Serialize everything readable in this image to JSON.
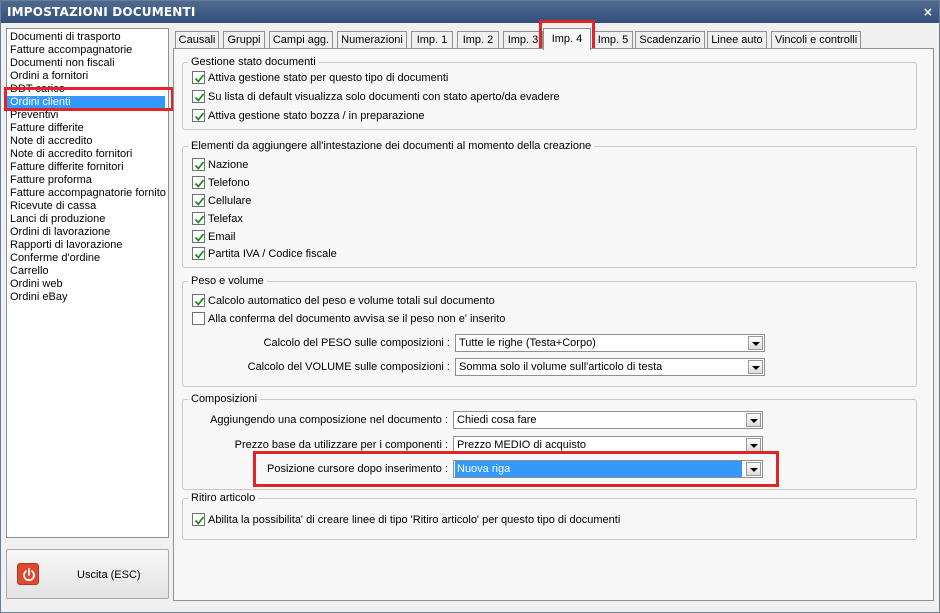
{
  "window": {
    "title": "IMPOSTAZIONI DOCUMENTI",
    "close_glyph": "×"
  },
  "sidebar": {
    "items": [
      {
        "label": "Documenti di trasporto"
      },
      {
        "label": "Fatture accompagnatorie"
      },
      {
        "label": "Documenti non fiscali"
      },
      {
        "label": "Ordini a fornitori"
      },
      {
        "label": "DDT carico"
      },
      {
        "label": "Ordini clienti",
        "selected": true
      },
      {
        "label": "Preventivi"
      },
      {
        "label": "Fatture differite"
      },
      {
        "label": "Note di accredito"
      },
      {
        "label": "Note di accredito fornitori"
      },
      {
        "label": "Fatture differite fornitori"
      },
      {
        "label": "Fatture proforma"
      },
      {
        "label": "Fatture accompagnatorie fornito"
      },
      {
        "label": "Ricevute di cassa"
      },
      {
        "label": "Lanci di produzione"
      },
      {
        "label": "Ordini di lavorazione"
      },
      {
        "label": "Rapporti di lavorazione"
      },
      {
        "label": "Conferme d'ordine"
      },
      {
        "label": "Carrello"
      },
      {
        "label": "Ordini web"
      },
      {
        "label": "Ordini eBay"
      }
    ]
  },
  "exit_button": {
    "label": "Uscita (ESC)",
    "icon": "power-icon"
  },
  "tabs": [
    {
      "label": "Causali"
    },
    {
      "label": "Gruppi"
    },
    {
      "label": "Campi agg."
    },
    {
      "label": "Numerazioni"
    },
    {
      "label": "Imp. 1"
    },
    {
      "label": "Imp. 2"
    },
    {
      "label": "Imp. 3"
    },
    {
      "label": "Imp. 4",
      "active": true
    },
    {
      "label": "Imp. 5"
    },
    {
      "label": "Scadenzario"
    },
    {
      "label": "Linee auto"
    },
    {
      "label": "Vincoli e controlli"
    }
  ],
  "groups": {
    "stato": {
      "title": "Gestione stato documenti",
      "options": [
        {
          "label": "Attiva gestione stato per questo tipo di documenti",
          "checked": true
        },
        {
          "label": "Su lista di default visualizza solo documenti con stato aperto/da evadere",
          "checked": true
        },
        {
          "label": "Attiva gestione stato bozza / in preparazione",
          "checked": true
        }
      ]
    },
    "intestazione": {
      "title": "Elementi da aggiungere all'intestazione dei documenti al momento della creazione",
      "options": [
        {
          "label": "Nazione",
          "checked": true
        },
        {
          "label": "Telefono",
          "checked": true
        },
        {
          "label": "Cellulare",
          "checked": true
        },
        {
          "label": "Telefax",
          "checked": true
        },
        {
          "label": "Email",
          "checked": true
        },
        {
          "label": "Partita IVA / Codice fiscale",
          "checked": true
        }
      ]
    },
    "peso": {
      "title": "Peso e volume",
      "options": [
        {
          "label": "Calcolo automatico del peso e volume totali sul documento",
          "checked": true
        },
        {
          "label": "Alla conferma del documento avvisa se il peso non e' inserito",
          "checked": false
        }
      ],
      "fields": [
        {
          "label": "Calcolo del PESO sulle composizioni :",
          "value": "Tutte le righe (Testa+Corpo)"
        },
        {
          "label": "Calcolo del VOLUME sulle composizioni :",
          "value": "Somma solo il volume sull'articolo di testa"
        }
      ]
    },
    "composizioni": {
      "title": "Composizioni",
      "fields": [
        {
          "label": "Aggiungendo una composizione nel documento :",
          "value": "Chiedi cosa fare"
        },
        {
          "label": "Prezzo base da utilizzare per i componenti :",
          "value": "Prezzo MEDIO di acquisto"
        },
        {
          "label": "Posizione cursore dopo inserimento :",
          "value": "Nuova riga"
        }
      ]
    },
    "ritiro": {
      "title": "Ritiro articolo",
      "options": [
        {
          "label": "Abilita la possibilita' di creare linee di tipo 'Ritiro articolo' per questo tipo di documenti",
          "checked": true
        }
      ]
    }
  },
  "colors": {
    "highlight": "#e0242a",
    "selection": "#3399ff",
    "titlebar": "#3f5b84",
    "check": "#1f8a1f"
  }
}
